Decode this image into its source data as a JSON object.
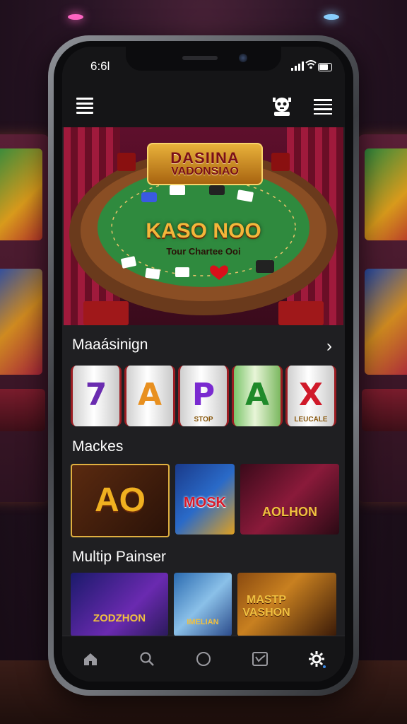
{
  "status_bar": {
    "time": "6:6l"
  },
  "hero": {
    "logo_line1": "DASIINA",
    "logo_line2": "VADONSIAO",
    "table_title": "KASO NOO",
    "table_subtitle": "Tour Chartee Ooi"
  },
  "sections": {
    "featured": {
      "title": "Maaásinign"
    },
    "reels": [
      {
        "symbol": "7",
        "caption": ""
      },
      {
        "symbol": "A",
        "caption": ""
      },
      {
        "symbol": "P",
        "caption": "STOP"
      },
      {
        "symbol": "A",
        "caption": ""
      },
      {
        "symbol": "X",
        "caption": "LEUCALE"
      }
    ],
    "games": {
      "title": "Mackes",
      "items": [
        {
          "label": "AO"
        },
        {
          "label": "MOSK"
        },
        {
          "label": "AOLHON"
        }
      ]
    },
    "multiplayer": {
      "title": "Multip Painser",
      "items": [
        {
          "label": "ZODZHON"
        },
        {
          "label": "IMELIAN"
        },
        {
          "label": "MASTP VASHON"
        }
      ]
    }
  },
  "colors": {
    "background": "#1f1f22",
    "accent_gold": "#f4b63a",
    "felt_green": "#2f8a3e",
    "curtain_red": "#a01a3c"
  },
  "icons": [
    "hamburger-menu-icon",
    "robot-icon",
    "list-icon",
    "home-icon",
    "search-icon",
    "circle-icon",
    "chart-icon",
    "settings-icon"
  ]
}
